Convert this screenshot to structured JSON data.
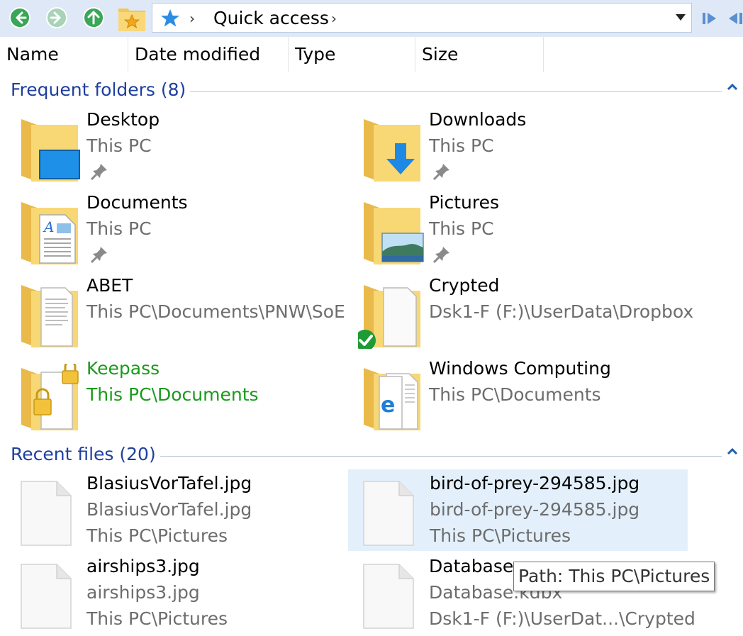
{
  "address": {
    "crumb": "Quick access"
  },
  "columns": [
    "Name",
    "Date modified",
    "Type",
    "Size"
  ],
  "groups": {
    "frequent": "Frequent folders (8)",
    "recent": "Recent files (20)"
  },
  "frequent_folders": [
    {
      "name": "Desktop",
      "location": "This PC"
    },
    {
      "name": "Downloads",
      "location": "This PC"
    },
    {
      "name": "Documents",
      "location": "This PC"
    },
    {
      "name": "Pictures",
      "location": "This PC"
    },
    {
      "name": "ABET",
      "location": "This PC\\Documents\\PNW\\SoE"
    },
    {
      "name": "Crypted",
      "location": "Dsk1-F (F:)\\UserData\\Dropbox"
    },
    {
      "name": "Keepass",
      "location": "This PC\\Documents"
    },
    {
      "name": "Windows Computing",
      "location": "This PC\\Documents"
    }
  ],
  "recent_files": [
    {
      "name": "BlasiusVorTafel.jpg",
      "original": "BlasiusVorTafel.jpg",
      "location": "This PC\\Pictures"
    },
    {
      "name": "bird-of-prey-294585.jpg",
      "original": "bird-of-prey-294585.jpg",
      "location": "This PC\\Pictures"
    },
    {
      "name": "airships3.jpg",
      "original": "airships3.jpg",
      "location": "This PC\\Pictures"
    },
    {
      "name": "Database.",
      "original": "Database.kdbx",
      "location": "Dsk1-F (F:)\\UserDat...\\Crypted"
    }
  ],
  "tooltip": "Path: This PC\\Pictures",
  "colors": {
    "group_title": "#1f3fa0",
    "accent_blue": "#2b7fd6",
    "green_text": "#1a9a1a",
    "selection": "#e3f0fc"
  }
}
